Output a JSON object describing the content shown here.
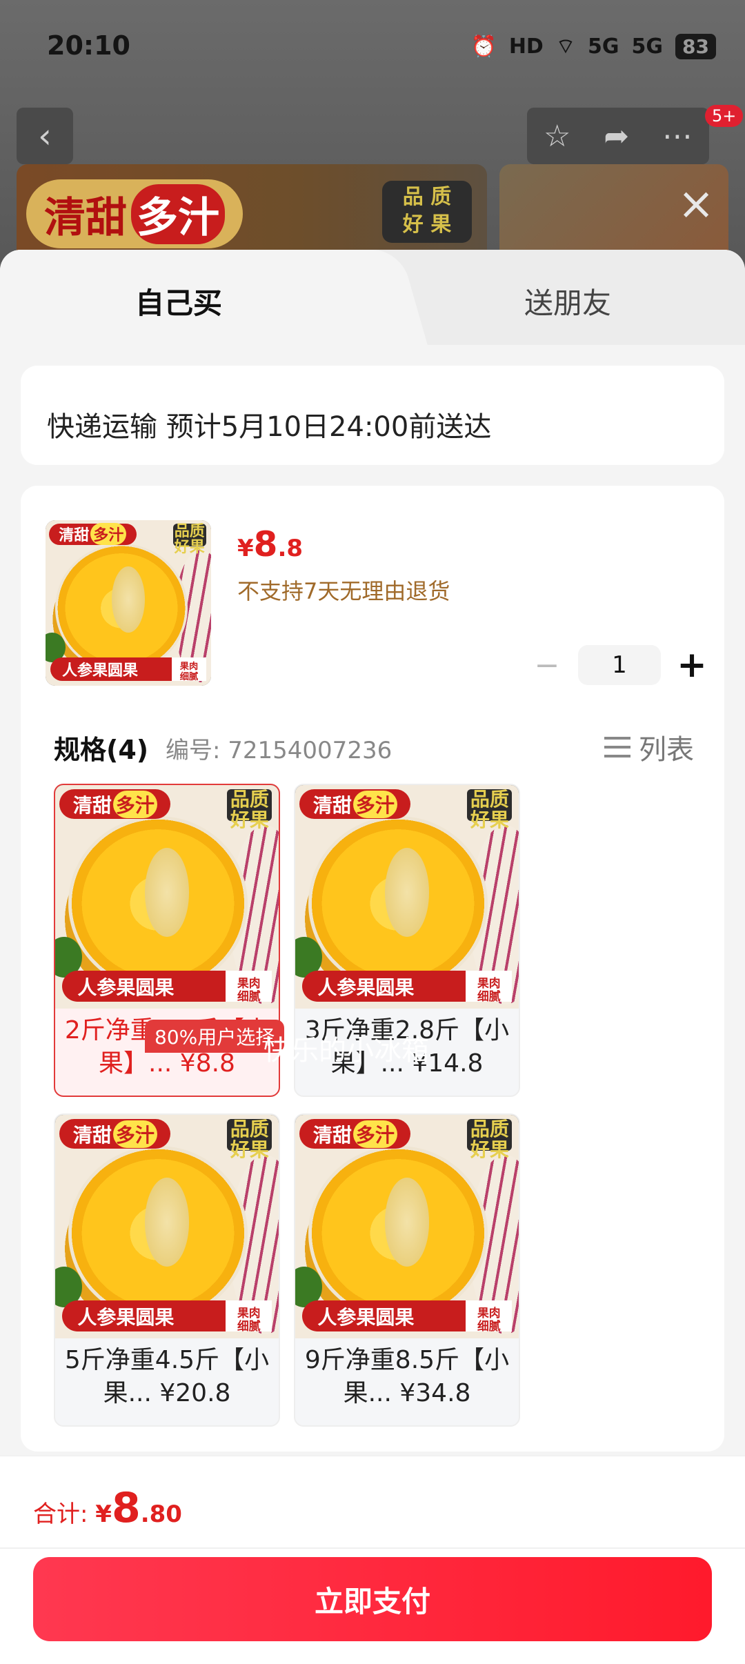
{
  "status_bar": {
    "time": "20:10",
    "hd": "HD",
    "signal1": "5G",
    "signal2": "5G",
    "battery": "83"
  },
  "nav": {
    "back": "‹",
    "badge": "5+"
  },
  "banner": {
    "tag_part1": "清甜",
    "tag_part2": "多汁",
    "quality_line1": "品 质",
    "quality_line2": "好 果"
  },
  "tabs": {
    "self": "自己买",
    "friend": "送朋友"
  },
  "shipping": {
    "text": "快递运输 预计5月10日24:00前送达"
  },
  "product": {
    "price_currency": "¥",
    "price_int": "8",
    "price_dec": ".8",
    "return_policy": "不支持7天无理由退货",
    "quantity": "1",
    "image": {
      "tag1": "清甜",
      "tag2": "多汁",
      "qual1": "品质",
      "qual2": "好果",
      "bottom": "人参果圆果",
      "bottom_r1": "果肉",
      "bottom_r2": "细腻"
    }
  },
  "spec": {
    "title": "规格(4)",
    "code": "编号: 72154007236",
    "list_label": "列表",
    "popular_badge": "80%用户选择",
    "options": [
      {
        "line1": "2斤净重1.8斤【小",
        "line2": "果】... ¥8.8",
        "selected": true
      },
      {
        "line1": "3斤净重2.8斤【小",
        "line2": "果】... ¥14.8",
        "selected": false
      },
      {
        "line1": "5斤净重4.5斤【小",
        "line2": "果... ¥20.8",
        "selected": false
      },
      {
        "line1": "9斤净重8.5斤【小",
        "line2": "果... ¥34.8",
        "selected": false
      }
    ]
  },
  "watermark": "快乐的小冰箱",
  "footer": {
    "total_label": "合计: ",
    "total_currency": "¥",
    "total_int": "8",
    "total_dec": ".80",
    "pay_button": "立即支付"
  },
  "colors": {
    "accent": "#e0201f",
    "pay_button": "#ff2238",
    "return_text": "#a06a2a"
  }
}
